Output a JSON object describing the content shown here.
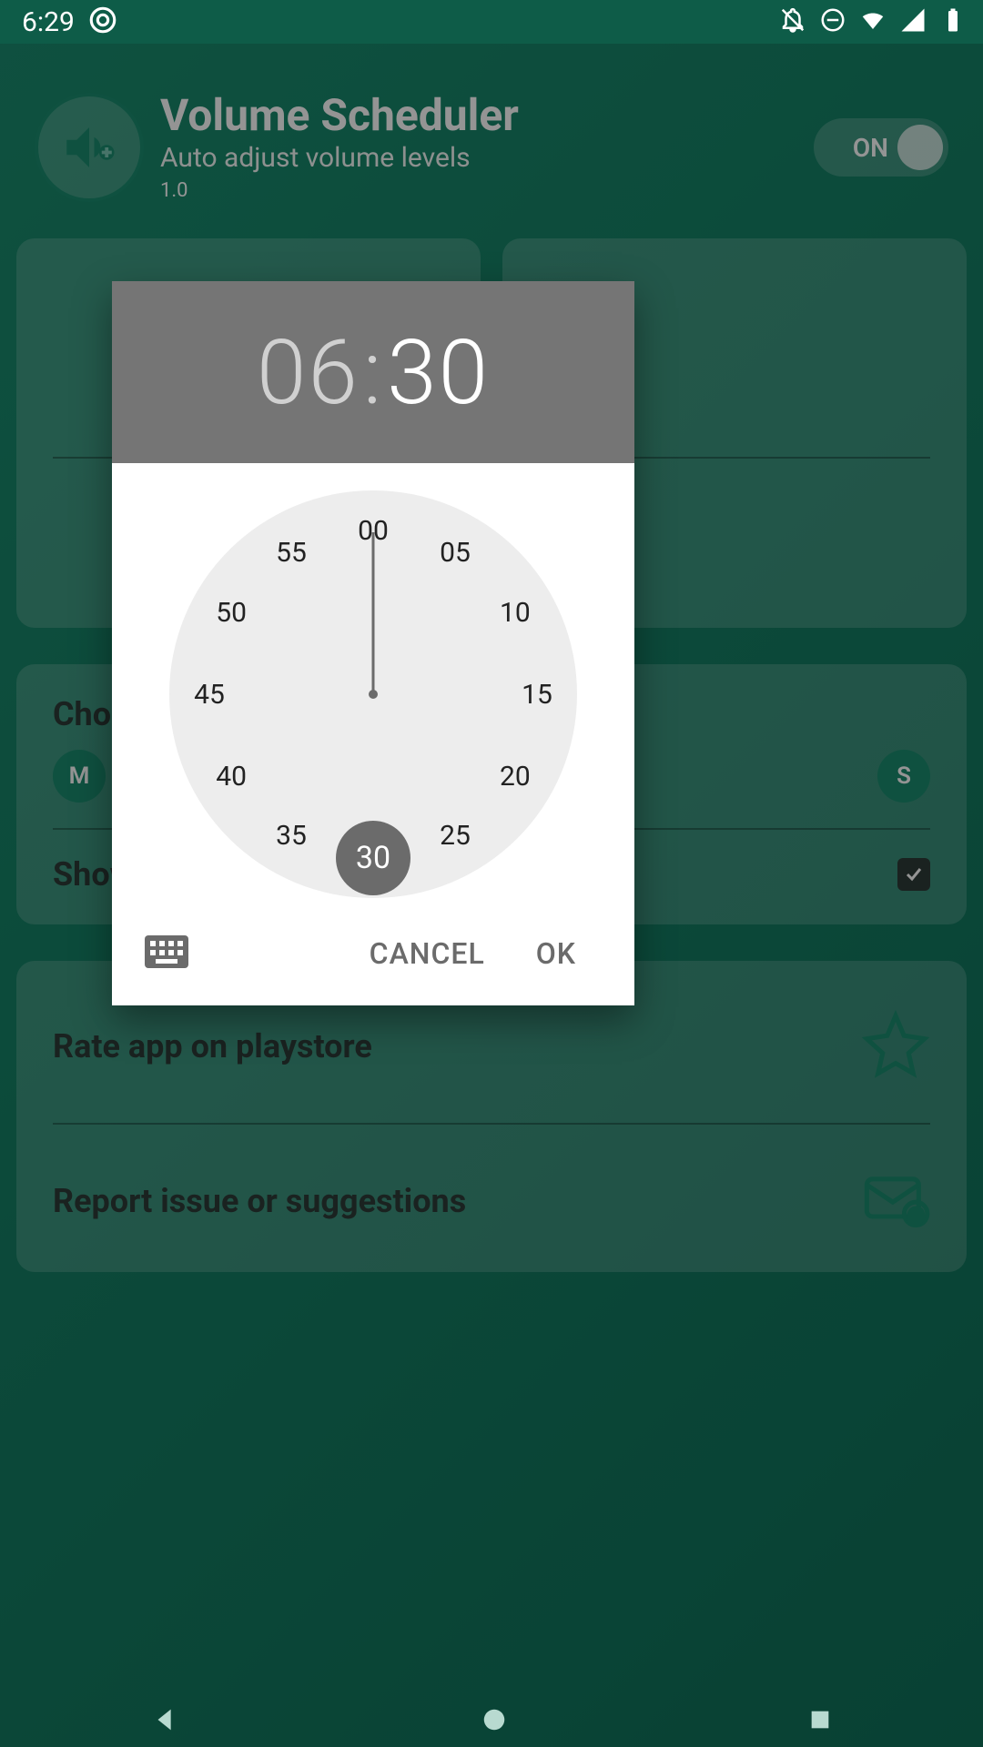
{
  "status": {
    "time": "6:29"
  },
  "header": {
    "title": "Volume Scheduler",
    "subtitle": "Auto adjust volume levels",
    "version": "1.0",
    "toggle_label": "ON"
  },
  "days_card": {
    "choose_label": "Choose",
    "day_m": "M",
    "day_s": "S",
    "show_label": "Show"
  },
  "list": {
    "rate_label": "Rate app on playstore",
    "report_label": "Report issue or suggestions"
  },
  "time_picker": {
    "hour": "06",
    "minute": "30",
    "ticks": [
      "00",
      "05",
      "10",
      "15",
      "20",
      "25",
      "30",
      "35",
      "40",
      "45",
      "50",
      "55"
    ],
    "selected_index": 6,
    "cancel": "CANCEL",
    "ok": "OK"
  }
}
